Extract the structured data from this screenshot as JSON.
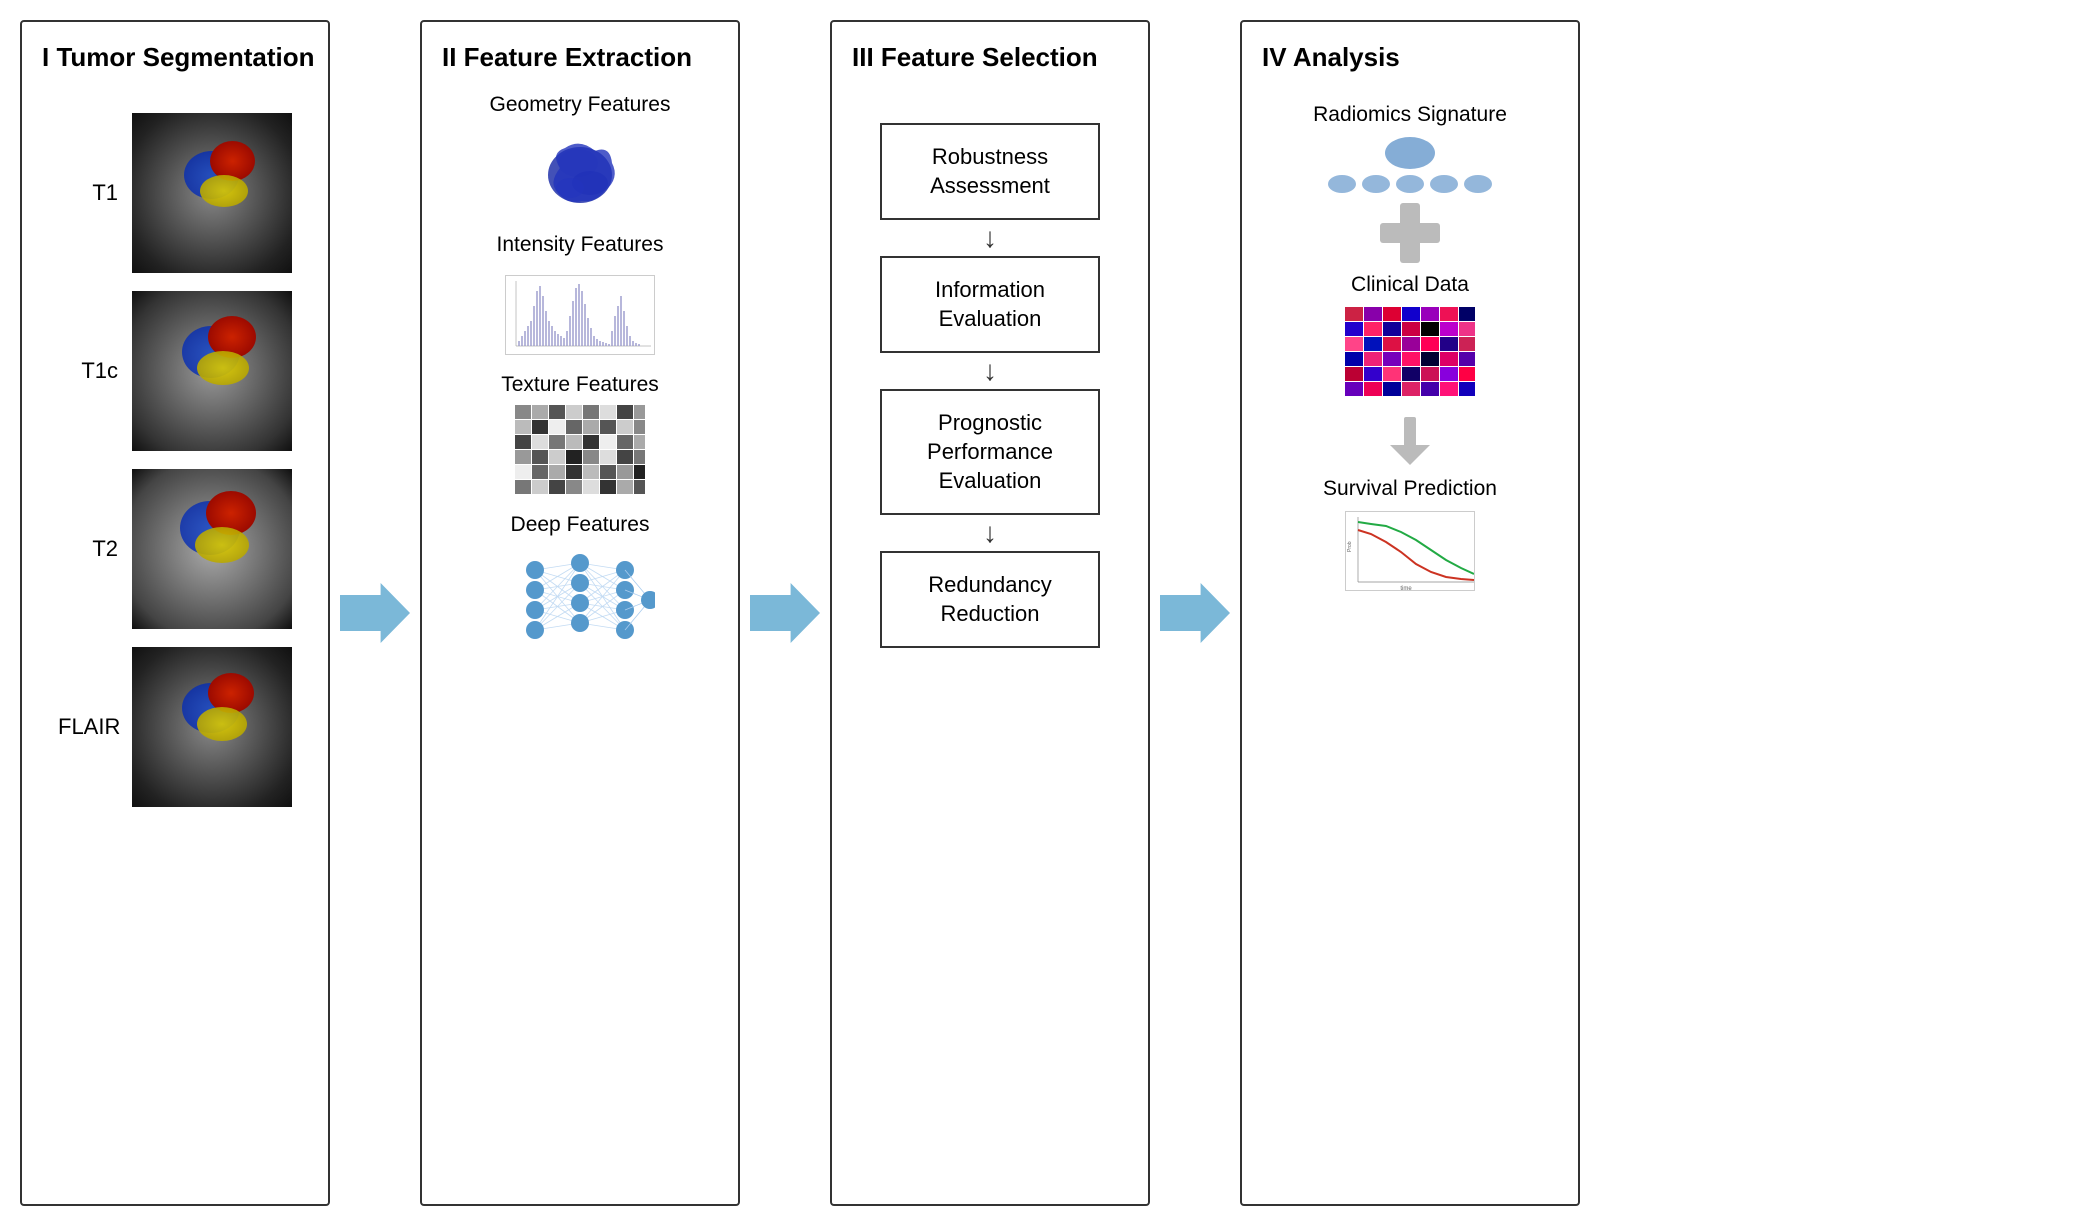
{
  "sections": {
    "s1": {
      "title": "I  Tumor Segmentation",
      "images": [
        {
          "label": "T1"
        },
        {
          "label": "T1c"
        },
        {
          "label": "T2"
        },
        {
          "label": "FLAIR"
        }
      ]
    },
    "s2": {
      "title": "II  Feature Extraction",
      "features": [
        {
          "label": "Geometry Features"
        },
        {
          "label": "Intensity Features"
        },
        {
          "label": "Texture Features"
        },
        {
          "label": "Deep Features"
        }
      ]
    },
    "s3": {
      "title": "III  Feature Selection",
      "steps": [
        {
          "label": "Robustness\nAssessment"
        },
        {
          "label": "Information\nEvaluation"
        },
        {
          "label": "Prognostic\nPerformance\nEvaluation"
        },
        {
          "label": "Redundancy\nReduction"
        }
      ]
    },
    "s4": {
      "title": "IV  Analysis",
      "items": [
        {
          "label": "Radiomics Signature"
        },
        {
          "label": "Clinical Data"
        },
        {
          "label": "Survival Prediction"
        }
      ]
    }
  }
}
